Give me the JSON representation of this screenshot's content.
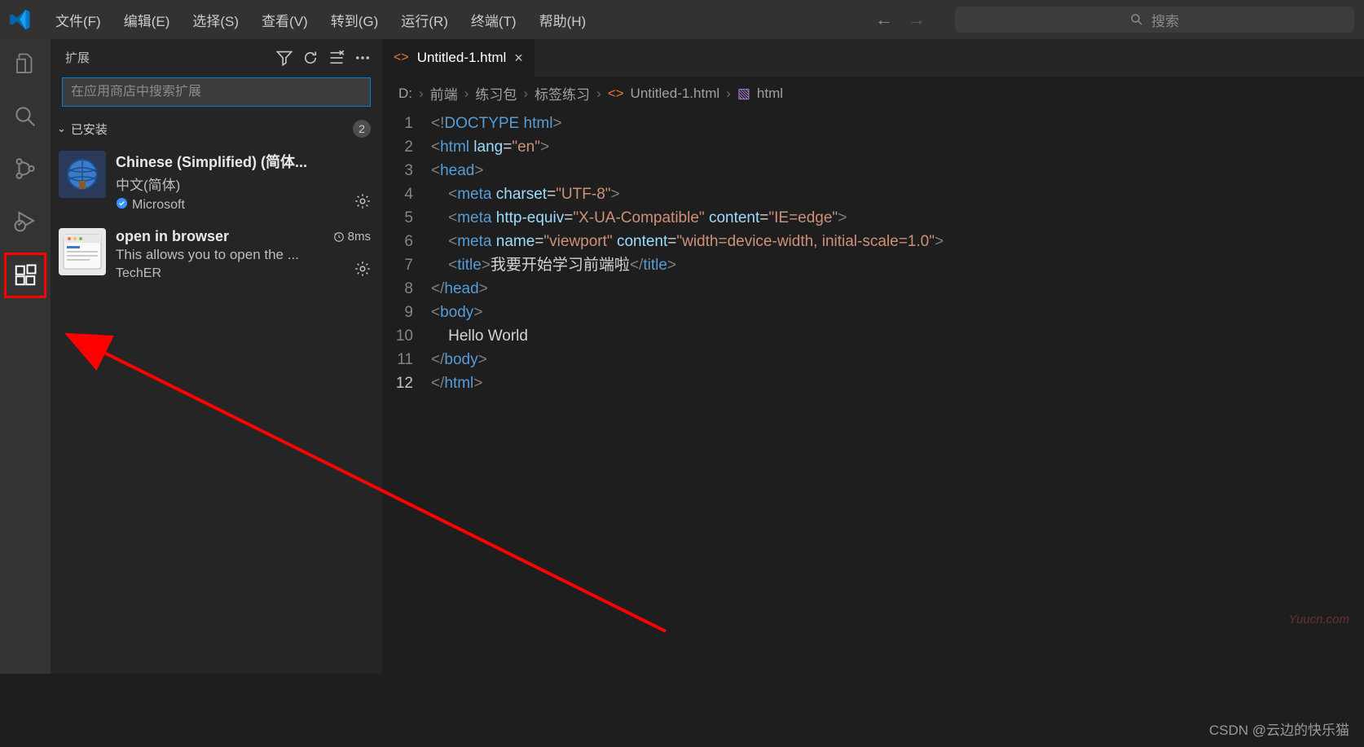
{
  "menu": [
    "文件(F)",
    "编辑(E)",
    "选择(S)",
    "查看(V)",
    "转到(G)",
    "运行(R)",
    "终端(T)",
    "帮助(H)"
  ],
  "search": {
    "placeholder": "搜索"
  },
  "sidebar": {
    "title": "扩展",
    "search_placeholder": "在应用商店中搜索扩展",
    "section": {
      "label": "已安装",
      "count": "2"
    }
  },
  "extensions": [
    {
      "title": "Chinese (Simplified) (简体...",
      "desc": "中文(简体)",
      "publisher": "Microsoft",
      "verified": true,
      "time": ""
    },
    {
      "title": "open in browser",
      "desc": "This allows you to open the ...",
      "publisher": "TechER",
      "verified": false,
      "time": "8ms"
    }
  ],
  "tab": {
    "name": "Untitled-1.html"
  },
  "breadcrumb": {
    "parts": [
      "D:",
      "前端",
      "练习包",
      "标签练习",
      "Untitled-1.html",
      "html"
    ]
  },
  "code": {
    "numbers": [
      "1",
      "2",
      "3",
      "4",
      "5",
      "6",
      "7",
      "8",
      "9",
      "10",
      "11",
      "12"
    ],
    "current_line": "12",
    "doctype": {
      "open": "<!",
      "name": "DOCTYPE",
      "arg": "html",
      "close": ">"
    },
    "html_open": {
      "tag": "html",
      "attr": "lang",
      "val": "\"en\""
    },
    "head_open": "head",
    "meta1": {
      "tag": "meta",
      "a1": "charset",
      "v1": "\"UTF-8\""
    },
    "meta2": {
      "tag": "meta",
      "a1": "http-equiv",
      "v1": "\"X-UA-Compatible\"",
      "a2": "content",
      "v2": "\"IE=edge\""
    },
    "meta3": {
      "tag": "meta",
      "a1": "name",
      "v1": "\"viewport\"",
      "a2": "content",
      "v2": "\"width=device-width, initial-scale=1.0\""
    },
    "title": {
      "tag": "title",
      "text": "我要开始学习前端啦"
    },
    "head_close": "head",
    "body_open": "body",
    "hello": "Hello World",
    "body_close": "body",
    "html_close": "html"
  },
  "watermark1": "Yuucn.com",
  "watermark2": "CSDN @云边的快乐猫"
}
